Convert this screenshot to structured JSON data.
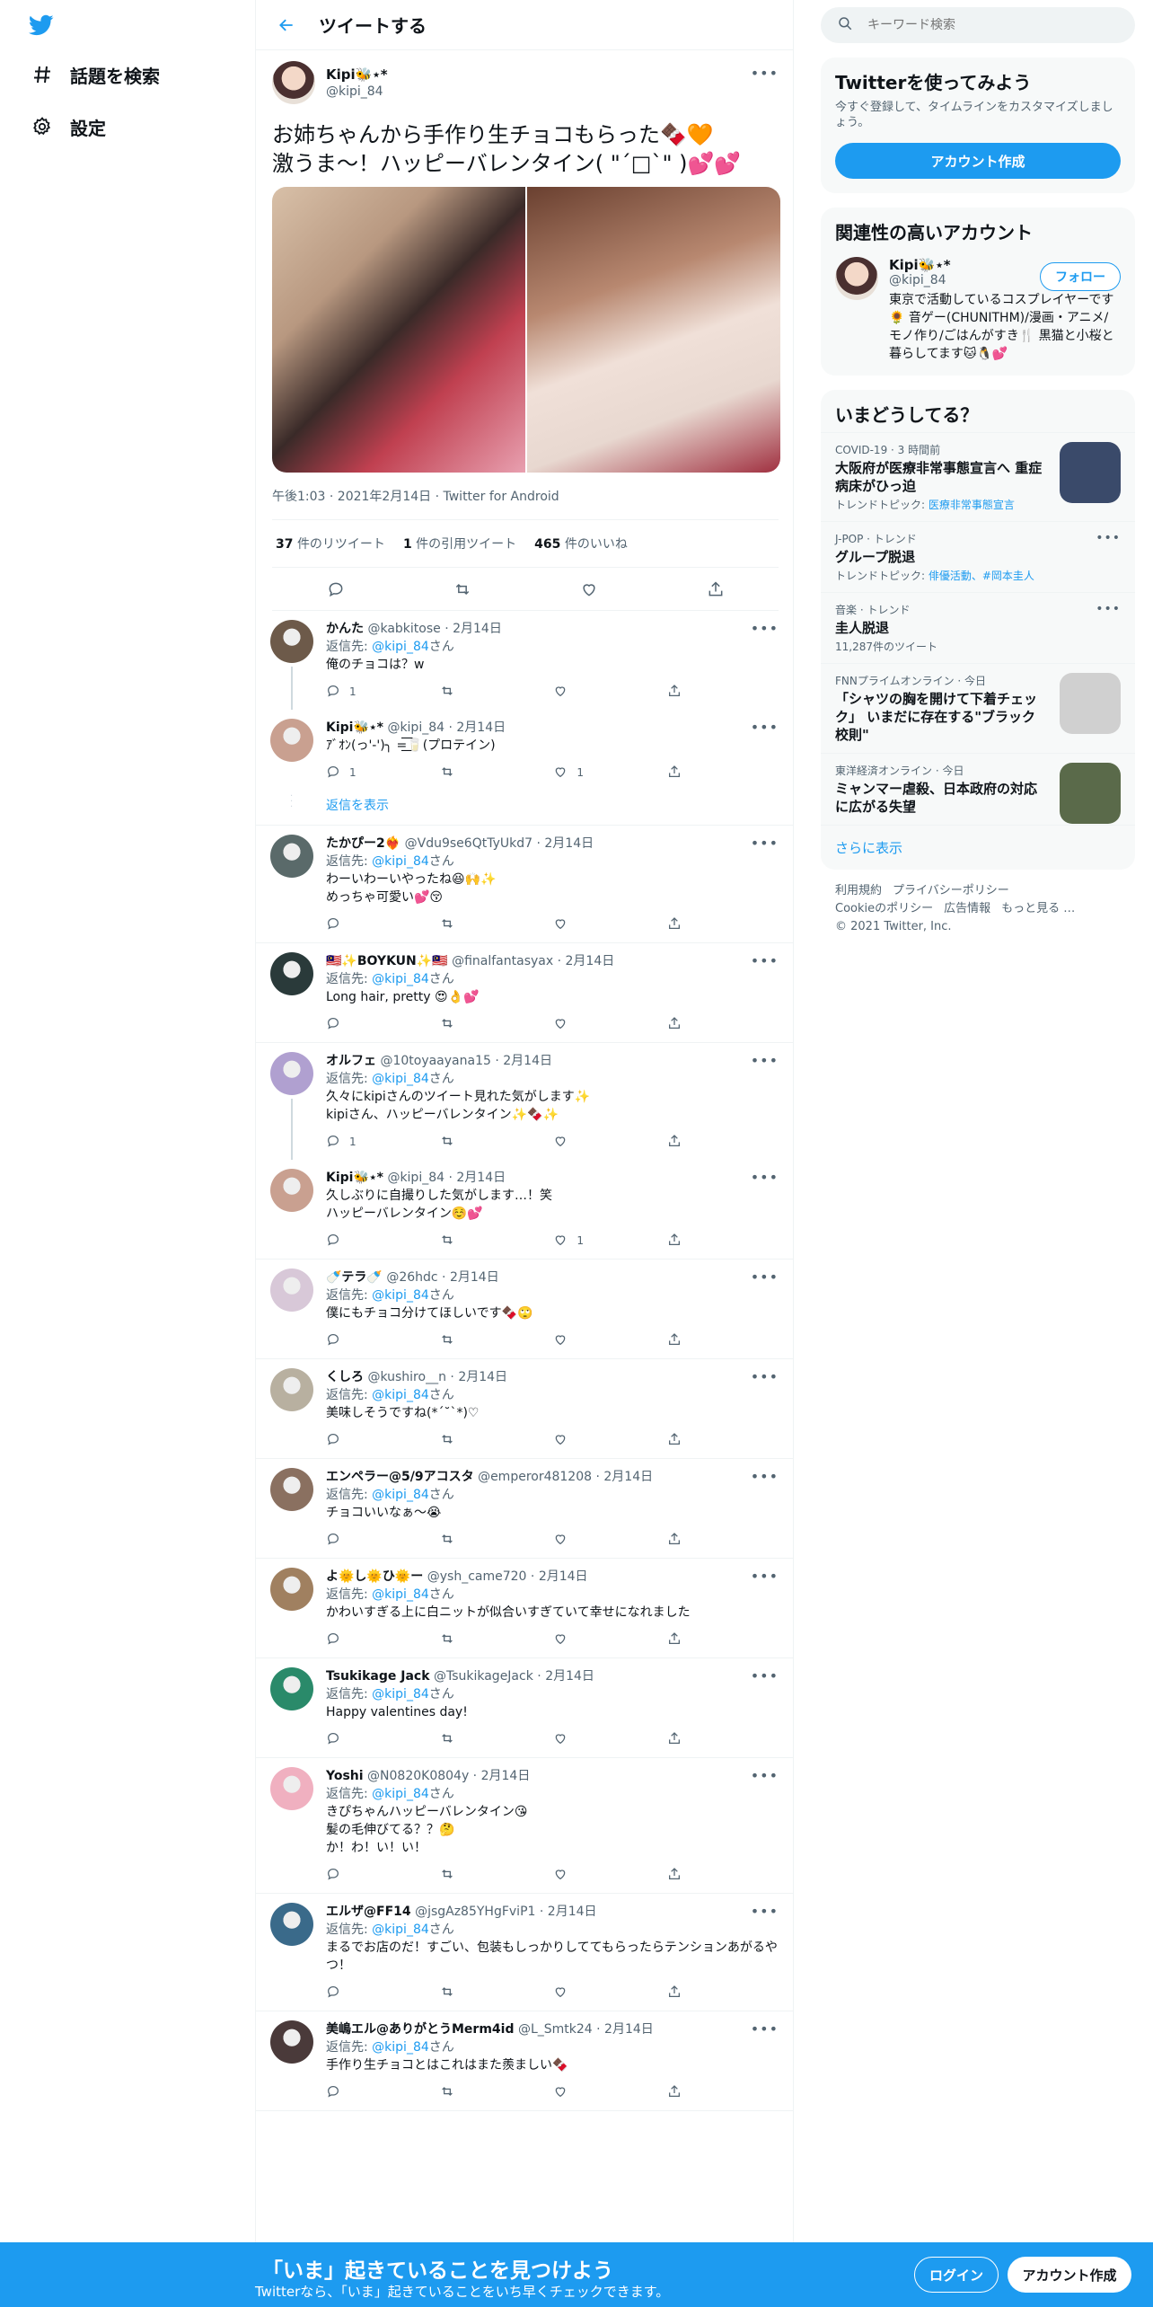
{
  "nav": {
    "explore_label": "話題を検索",
    "settings_label": "設定"
  },
  "header": {
    "title": "ツイートする"
  },
  "focal": {
    "name": "Kipi🐝⋆*",
    "handle": "@kipi_84",
    "text": "お姉ちゃんから手作り生チョコもらった🍫🧡\n激うま～！ハッピーバレンタイン( \"´□`\" )💕💕",
    "meta": "午後1:03 · 2021年2月14日 · Twitter for Android",
    "retweets": "37",
    "retweets_label": "件のリツイート",
    "quotes": "1",
    "quotes_label": "件の引用ツイート",
    "likes": "465",
    "likes_label": "件のいいね"
  },
  "replies": [
    {
      "name": "かんた",
      "handle": "@kabkitose",
      "date": "2月14日",
      "replying": "返信先:",
      "to": "@kipi_84",
      "san": "さん",
      "text": "俺のチョコは？w",
      "reply_count": "1",
      "like_count": "",
      "avatar": "#6d5a4a"
    },
    {
      "name": "Kipi🐝⋆*",
      "handle": "@kipi_84",
      "date": "2月14日",
      "replying": "",
      "to": "",
      "san": "",
      "text": "ｱﾞｵﾝ(っ'-')╮ =͟͟͞͞🥛(プロテイン)",
      "reply_count": "1",
      "like_count": "1",
      "avatar": "#c9a090"
    },
    {
      "name": "たかぴー2❤️‍🔥",
      "handle": "@Vdu9se6QtTyUkd7",
      "date": "2月14日",
      "replying": "返信先:",
      "to": "@kipi_84",
      "san": "さん",
      "text": "わーいわーいやったね😆🙌✨\nめっちゃ可愛い💕😚",
      "reply_count": "",
      "like_count": "",
      "avatar": "#5a6a6a"
    },
    {
      "name": "🇲🇾✨BOYKUN✨🇲🇾",
      "handle": "@finalfantasyax",
      "date": "2月14日",
      "replying": "返信先:",
      "to": "@kipi_84",
      "san": "さん",
      "text": "Long hair, pretty 😍👌💕",
      "reply_count": "",
      "like_count": "",
      "avatar": "#2a3a3a"
    },
    {
      "name": "オルフェ",
      "handle": "@10toyaayana15",
      "date": "2月14日",
      "replying": "返信先:",
      "to": "@kipi_84",
      "san": "さん",
      "text": "久々にkipiさんのツイート見れた気がします✨\nkipiさん、ハッピーバレンタイン✨🍫✨",
      "reply_count": "1",
      "like_count": "",
      "avatar": "#b0a0d0"
    },
    {
      "name": "Kipi🐝⋆*",
      "handle": "@kipi_84",
      "date": "2月14日",
      "replying": "",
      "to": "",
      "san": "",
      "text": "久しぶりに自撮りした気がします…！笑\nハッピーバレンタイン☺️💕",
      "reply_count": "",
      "like_count": "1",
      "avatar": "#c9a090"
    },
    {
      "name": "🍼テラ🍼",
      "handle": "@26hdc",
      "date": "2月14日",
      "replying": "返信先:",
      "to": "@kipi_84",
      "san": "さん",
      "text": "僕にもチョコ分けてほしいです🍫🙄",
      "reply_count": "",
      "like_count": "",
      "avatar": "#d8c8d8"
    },
    {
      "name": "くしろ",
      "handle": "@kushiro__n",
      "date": "2月14日",
      "replying": "返信先:",
      "to": "@kipi_84",
      "san": "さん",
      "text": "美味しそうですね(*´˘`*)♡",
      "reply_count": "",
      "like_count": "",
      "avatar": "#b8b0a0"
    },
    {
      "name": "エンペラー@5/9アコスタ",
      "handle": "@emperor481208",
      "date": "2月14日",
      "replying": "返信先:",
      "to": "@kipi_84",
      "san": "さん",
      "text": "チョコいいなぁ～😭",
      "reply_count": "",
      "like_count": "",
      "avatar": "#8a7060"
    },
    {
      "name": "よ🌞し🌞ひ🌞ー",
      "handle": "@ysh_came720",
      "date": "2月14日",
      "replying": "返信先:",
      "to": "@kipi_84",
      "san": "さん",
      "text": "かわいすぎる上に白ニットが似合いすぎていて幸せになれました",
      "reply_count": "",
      "like_count": "",
      "avatar": "#a08060"
    },
    {
      "name": "Tsukikage Jack",
      "handle": "@TsukikageJack",
      "date": "2月14日",
      "replying": "返信先:",
      "to": "@kipi_84",
      "san": "さん",
      "text": "Happy valentines day!",
      "reply_count": "",
      "like_count": "",
      "avatar": "#2a8a6a"
    },
    {
      "name": "Yoshi",
      "handle": "@N0820K0804y",
      "date": "2月14日",
      "replying": "返信先:",
      "to": "@kipi_84",
      "san": "さん",
      "text": "きぴちゃんハッピーバレンタイン😘\n髪の毛伸びてる？？🤔\nか！わ！い！い！",
      "reply_count": "",
      "like_count": "",
      "avatar": "#f0b0c0"
    },
    {
      "name": "エルザ@FF14",
      "handle": "@jsgAz85YHgFviP1",
      "date": "2月14日",
      "replying": "返信先:",
      "to": "@kipi_84",
      "san": "さん",
      "text": "まるでお店のだ！すごい、包装もしっかりしててもらったらテンションあがるやつ！",
      "reply_count": "",
      "like_count": "",
      "avatar": "#3a6a8a"
    },
    {
      "name": "美嶋エル@ありがとうMerm4id",
      "handle": "@L_Smtk24",
      "date": "2月14日",
      "replying": "返信先:",
      "to": "@kipi_84",
      "san": "さん",
      "text": "手作り生チョコとはこれはまた羨ましい🍫",
      "reply_count": "",
      "like_count": "",
      "avatar": "#4a3a3a"
    }
  ],
  "show_replies_label": "返信を表示",
  "search": {
    "placeholder": "キーワード検索"
  },
  "signup_card": {
    "title": "Twitterを使ってみよう",
    "desc": "今すぐ登録して、タイムラインをカスタマイズしましょう。",
    "button": "アカウント作成"
  },
  "related": {
    "title": "関連性の高いアカウント",
    "name": "Kipi🐝⋆*",
    "handle": "@kipi_84",
    "follow": "フォロー",
    "bio": "東京で活動しているコスプレイヤーです🌻 音ゲー(CHUNITHM)/漫画・アニメ/モノ作り/ごはんがすき🍴 黒猫と小桜と暮らしてます🐱🐧💕"
  },
  "trends": {
    "title": "いまどうしてる？",
    "items": [
      {
        "ctx": "COVID-19 · 3 時間前",
        "title": "大阪府が医療非常事態宣言へ 重症病床がひっ迫",
        "sub_label": "トレンドトピック:",
        "sub_link": "医療非常事態宣言",
        "thumb": "#3a4a6a"
      },
      {
        "ctx": "J-POP · トレンド",
        "title": "グループ脱退",
        "sub_label": "トレンドトピック:",
        "sub_link": "俳優活動、#岡本圭人",
        "thumb": ""
      },
      {
        "ctx": "音楽 · トレンド",
        "title": "圭人脱退",
        "sub_label": "11,287件のツイート",
        "sub_link": "",
        "thumb": ""
      },
      {
        "ctx": "FNNプライムオンライン · 今日",
        "title": "「シャツの胸を開けて下着チェック」 いまだに存在する\"ブラック校則\"",
        "sub_label": "",
        "sub_link": "",
        "thumb": "#d0d0d0"
      },
      {
        "ctx": "東洋経済オンライン · 今日",
        "title": "ミャンマー虐殺、日本政府の対応に広がる失望",
        "sub_label": "",
        "sub_link": "",
        "thumb": "#5a6a4a"
      }
    ],
    "show_more": "さらに表示"
  },
  "footer": {
    "terms": "利用規約",
    "privacy": "プライバシーポリシー",
    "cookie": "Cookieのポリシー",
    "ads": "広告情報",
    "more": "もっと見る …",
    "copyright": "© 2021 Twitter, Inc."
  },
  "bottom_bar": {
    "headline": "「いま」起きていることを見つけよう",
    "sub": "Twitterなら、「いま」起きていることをいち早くチェックできます。",
    "login": "ログイン",
    "signup": "アカウント作成"
  },
  "colors": {
    "accent": "#1d9bf0",
    "text": "#0f1419",
    "muted": "#536471"
  }
}
